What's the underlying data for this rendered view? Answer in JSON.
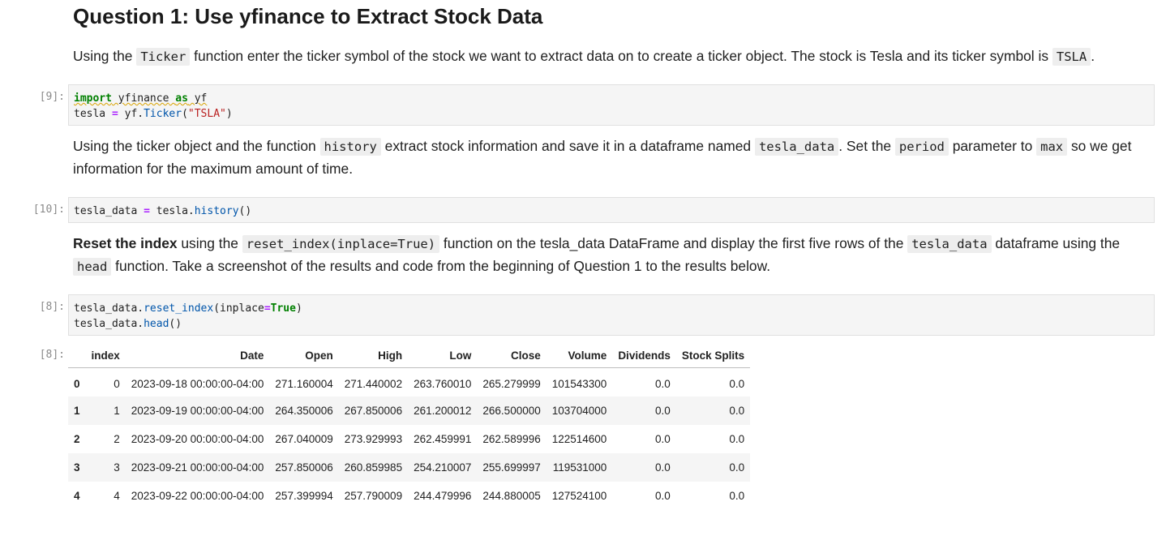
{
  "heading": "Question 1: Use yfinance to Extract Stock Data",
  "para1": {
    "t1": "Using the ",
    "c1": "Ticker",
    "t2": " function enter the ticker symbol of the stock we want to extract data on to create a ticker object. The stock is Tesla and its ticker symbol is ",
    "c2": "TSLA",
    "t3": "."
  },
  "cell1": {
    "prompt": "[9]:",
    "line1": {
      "kw1": "import",
      "mod": "yfinance",
      "kw2": "as",
      "alias": "yf"
    },
    "line2": {
      "var": "tesla",
      "eq": "=",
      "obj": "yf.",
      "fn": "Ticker",
      "open": "(",
      "str": "\"TSLA\"",
      "close": ")"
    }
  },
  "para2": {
    "t1": "Using the ticker object and the function ",
    "c1": "history",
    "t2": " extract stock information and save it in a dataframe named ",
    "c2": "tesla_data",
    "t3": ". Set the ",
    "c3": "period",
    "t4": " parameter to ",
    "c4": "max",
    "t5": " so we get information for the maximum amount of time."
  },
  "cell2": {
    "prompt": "[10]:",
    "var": "tesla_data",
    "eq": "=",
    "obj": "tesla.",
    "fn": "history",
    "args": "()"
  },
  "para3": {
    "bold": "Reset the index",
    "t1": " using the ",
    "c1": "reset_index(inplace=True)",
    "t2": " function on the tesla_data DataFrame and display the first five rows of the ",
    "c2": "tesla_data",
    "t3": " dataframe using the ",
    "c3": "head",
    "t4": " function. Take a screenshot of the results and code from the beginning of Question 1 to the results below."
  },
  "cell3": {
    "prompt": "[8]:",
    "line1": {
      "obj": "tesla_data.",
      "fn": "reset_index",
      "open": "(inplace",
      "eq": "=",
      "kw": "True",
      "close": ")"
    },
    "line2": {
      "obj": "tesla_data.",
      "fn": "head",
      "args": "()"
    }
  },
  "output": {
    "prompt": "[8]:",
    "columns": [
      "",
      "index",
      "Date",
      "Open",
      "High",
      "Low",
      "Close",
      "Volume",
      "Dividends",
      "Stock Splits"
    ],
    "rows": [
      [
        "0",
        "0",
        "2023-09-18 00:00:00-04:00",
        "271.160004",
        "271.440002",
        "263.760010",
        "265.279999",
        "101543300",
        "0.0",
        "0.0"
      ],
      [
        "1",
        "1",
        "2023-09-19 00:00:00-04:00",
        "264.350006",
        "267.850006",
        "261.200012",
        "266.500000",
        "103704000",
        "0.0",
        "0.0"
      ],
      [
        "2",
        "2",
        "2023-09-20 00:00:00-04:00",
        "267.040009",
        "273.929993",
        "262.459991",
        "262.589996",
        "122514600",
        "0.0",
        "0.0"
      ],
      [
        "3",
        "3",
        "2023-09-21 00:00:00-04:00",
        "257.850006",
        "260.859985",
        "254.210007",
        "255.699997",
        "119531000",
        "0.0",
        "0.0"
      ],
      [
        "4",
        "4",
        "2023-09-22 00:00:00-04:00",
        "257.399994",
        "257.790009",
        "244.479996",
        "244.880005",
        "127524100",
        "0.0",
        "0.0"
      ]
    ]
  }
}
